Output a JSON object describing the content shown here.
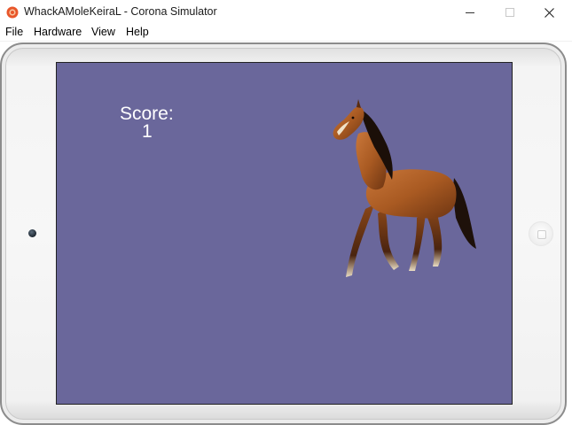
{
  "window": {
    "title": "WhackAMoleKeiraL - Corona Simulator",
    "controls": {
      "minimize": "—",
      "maximize": "☐",
      "close": "✕"
    }
  },
  "menu": {
    "items": [
      "File",
      "Hardware",
      "View",
      "Help"
    ]
  },
  "game": {
    "score_label": "Score:",
    "score_value": "1",
    "background_color": "#6a679b",
    "sprite": "horse-sprite"
  },
  "icons": {
    "app": "corona-app-icon",
    "camera": "camera-dot",
    "home": "home-button"
  }
}
